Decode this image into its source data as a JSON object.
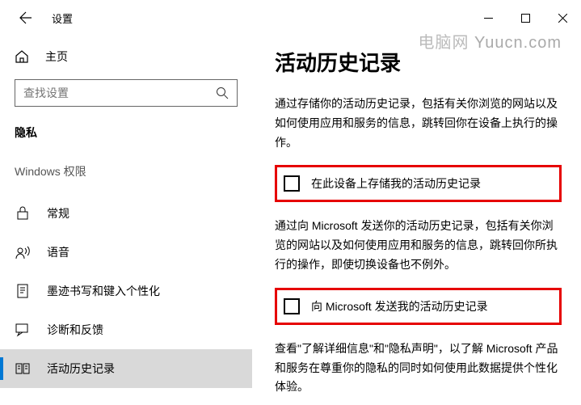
{
  "titlebar": {
    "title": "设置"
  },
  "sidebar": {
    "home": "主页",
    "search_placeholder": "查找设置",
    "category": "隐私",
    "subhead": "Windows 权限",
    "items": [
      {
        "label": "常规"
      },
      {
        "label": "语音"
      },
      {
        "label": "墨迹书写和键入个性化"
      },
      {
        "label": "诊断和反馈"
      },
      {
        "label": "活动历史记录"
      }
    ]
  },
  "content": {
    "title": "活动历史记录",
    "desc1": "通过存储你的活动历史记录，包括有关你浏览的网站以及如何使用应用和服务的信息，跳转回你在设备上执行的操作。",
    "check1": "在此设备上存储我的活动历史记录",
    "desc2": "通过向 Microsoft 发送你的活动历史记录，包括有关你浏览的网站以及如何使用应用和服务的信息，跳转回你所执行的操作，即使切换设备也不例外。",
    "check2": "向 Microsoft 发送我的活动历史记录",
    "desc3": "查看\"了解详细信息\"和\"隐私声明\"，以了解 Microsoft 产品和服务在尊重你的隐私的同时如何使用此数据提供个性化体验。"
  },
  "watermark": {
    "cn": "电脑网",
    "en": " Yuucn.com"
  }
}
